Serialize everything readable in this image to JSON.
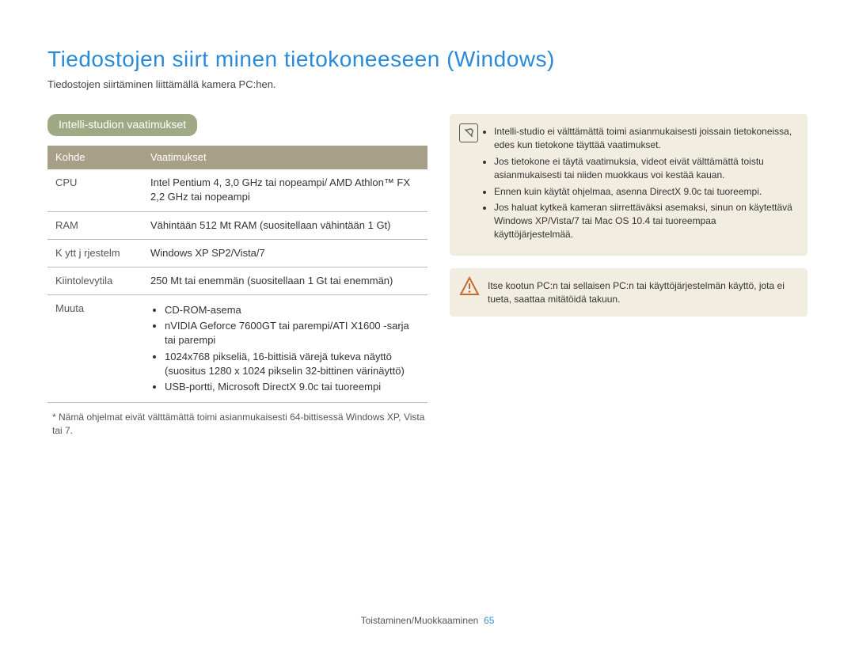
{
  "title": "Tiedostojen siirt minen tietokoneeseen (Windows)",
  "subtitle": "Tiedostojen siirtäminen liittämällä kamera PC:hen.",
  "section_heading": "Intelli-studion vaatimukset",
  "table": {
    "header_key": "Kohde",
    "header_value": "Vaatimukset",
    "rows": [
      {
        "key": "CPU",
        "value": "Intel Pentium 4, 3,0 GHz tai nopeampi/\nAMD Athlon™ FX 2,2 GHz tai nopeampi"
      },
      {
        "key": "RAM",
        "value": "Vähintään 512 Mt RAM\n(suositellaan vähintään 1 Gt)"
      },
      {
        "key": "K ytt j rjestelm",
        "value": "Windows XP SP2/Vista/7"
      },
      {
        "key": "Kiintolevytila",
        "value": "250 Mt tai enemmän\n(suositellaan 1 Gt tai enemmän)"
      }
    ],
    "other_key": "Muuta",
    "other_items": [
      "CD-ROM-asema",
      "nVIDIA Geforce 7600GT tai parempi/ATI X1600 -sarja tai parempi",
      "1024x768 pikseliä, 16-bittisiä värejä tukeva näyttö (suositus 1280 x 1024 pikselin 32-bittinen värinäyttö)",
      "USB-portti, Microsoft DirectX 9.0c tai tuoreempi"
    ]
  },
  "footnote": "* Nämä ohjelmat eivät välttämättä toimi asianmukaisesti 64-bittisessä Windows XP, Vista tai 7.",
  "note_items": [
    "Intelli-studio ei välttämättä toimi asianmukaisesti joissain tietokoneissa, edes kun tietokone täyttää vaatimukset.",
    "Jos tietokone ei täytä vaatimuksia, videot eivät välttämättä toistu asianmukaisesti tai niiden muokkaus voi kestää kauan.",
    "Ennen kuin käytät ohjelmaa, asenna DirectX 9.0c tai tuoreempi.",
    "Jos haluat kytkeä kameran siirrettäväksi asemaksi, sinun on käytettävä Windows XP/Vista/7 tai Mac OS 10.4 tai tuoreempaa käyttöjärjestelmää."
  ],
  "warn_text": "Itse kootun PC:n tai sellaisen PC:n tai käyttöjärjestelmän käyttö, jota ei tueta, saattaa mitätöidä takuun.",
  "footer_label": "Toistaminen/Muokkaaminen",
  "footer_page": "65"
}
